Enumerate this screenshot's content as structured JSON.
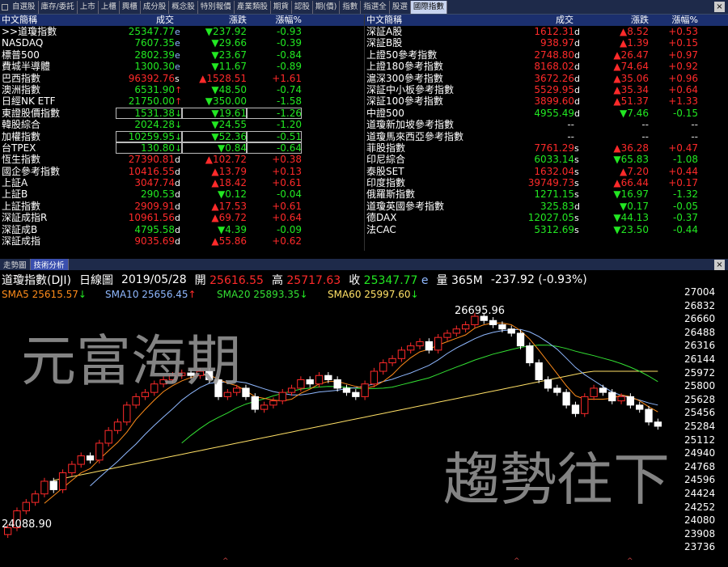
{
  "tabs": [
    "自選股",
    "庫存/委託",
    "上市",
    "上櫃",
    "興櫃",
    "成分股",
    "概念股",
    "特別報價",
    "產業類股",
    "期貨",
    "認股",
    "期(價)",
    "指數",
    "指選全",
    "股選",
    "國際指數"
  ],
  "left_header": {
    "name": "中文簡稱",
    "price": "成交",
    "change": "漲跌",
    "pct": "漲幅%"
  },
  "right_header": {
    "name": "中文簡稱",
    "price": "成交",
    "change": "漲跌",
    "pct": "漲幅%"
  },
  "left_rows": [
    {
      "name": ">>道瓊指數",
      "price": "25347.77",
      "suf": "e",
      "pc": "dn",
      "chg": "▼237.92",
      "cc": "dn",
      "pct": "-0.93",
      "box": false
    },
    {
      "name": "NASDAQ",
      "price": "7607.35",
      "suf": "e",
      "pc": "dn",
      "chg": "▼29.66",
      "cc": "dn",
      "pct": "-0.39",
      "box": false
    },
    {
      "name": "標普500",
      "price": "2802.39",
      "suf": "e",
      "pc": "dn",
      "chg": "▼23.67",
      "cc": "dn",
      "pct": "-0.84",
      "box": false
    },
    {
      "name": "費城半導體",
      "price": "1300.30",
      "suf": "e",
      "pc": "dn",
      "chg": "▼11.67",
      "cc": "dn",
      "pct": "-0.89",
      "box": false
    },
    {
      "name": "巴西指數",
      "price": "96392.76",
      "suf": "s",
      "pc": "up",
      "chg": "▲1528.51",
      "cc": "up",
      "pct": "+1.61",
      "box": false
    },
    {
      "name": "澳洲指數",
      "price": "6531.90",
      "suf": "↑",
      "pc": "dn",
      "chg": "▼48.50",
      "cc": "dn",
      "pct": "-0.74",
      "box": false
    },
    {
      "name": "日經NK ETF",
      "price": "21750.00",
      "suf": "↑",
      "pc": "dn",
      "chg": "▼350.00",
      "cc": "dn",
      "pct": "-1.58",
      "box": false
    },
    {
      "name": "東證股價指數",
      "price": "1531.38",
      "suf": "↓",
      "pc": "dn",
      "chg": "▼19.61",
      "cc": "dn",
      "pct": "-1.26",
      "box": true
    },
    {
      "name": "韓股綜合",
      "price": "2024.28",
      "suf": "↓",
      "pc": "dn",
      "chg": "▼24.55",
      "cc": "dn",
      "pct": "-1.20",
      "box": false
    },
    {
      "name": "加權指數",
      "price": "10259.95",
      "suf": "↓",
      "pc": "dn",
      "chg": "▼52.36",
      "cc": "dn",
      "pct": "-0.51",
      "box": true
    },
    {
      "name": "台TPEX",
      "price": "130.80",
      "suf": "↓",
      "pc": "dn",
      "chg": "▼0.84",
      "cc": "dn",
      "pct": "-0.64",
      "box": true
    },
    {
      "name": "恆生指數",
      "price": "27390.81",
      "suf": "d",
      "pc": "up",
      "chg": "▲102.72",
      "cc": "up",
      "pct": "+0.38",
      "box": false
    },
    {
      "name": "國企參考指數",
      "price": "10416.55",
      "suf": "d",
      "pc": "up",
      "chg": "▲13.79",
      "cc": "up",
      "pct": "+0.13",
      "box": false
    },
    {
      "name": "上証A",
      "price": "3047.74",
      "suf": "d",
      "pc": "up",
      "chg": "▲18.42",
      "cc": "up",
      "pct": "+0.61",
      "box": false
    },
    {
      "name": "上証B",
      "price": "290.53",
      "suf": "d",
      "pc": "dn",
      "chg": "▼0.12",
      "cc": "dn",
      "pct": "-0.04",
      "box": false
    },
    {
      "name": "上証指數",
      "price": "2909.91",
      "suf": "d",
      "pc": "up",
      "chg": "▲17.53",
      "cc": "up",
      "pct": "+0.61",
      "box": false
    },
    {
      "name": "深証成指R",
      "price": "10961.56",
      "suf": "d",
      "pc": "up",
      "chg": "▲69.72",
      "cc": "up",
      "pct": "+0.64",
      "box": false
    },
    {
      "name": "深証成B",
      "price": "4795.58",
      "suf": "d",
      "pc": "dn",
      "chg": "▼4.39",
      "cc": "dn",
      "pct": "-0.09",
      "box": false
    },
    {
      "name": "深証成指",
      "price": "9035.69",
      "suf": "d",
      "pc": "up",
      "chg": "▲55.86",
      "cc": "up",
      "pct": "+0.62",
      "box": false
    }
  ],
  "right_rows": [
    {
      "name": "深証A股",
      "price": "1612.31",
      "suf": "d",
      "pc": "up",
      "chg": "▲8.52",
      "cc": "up",
      "pct": "+0.53"
    },
    {
      "name": "深証B股",
      "price": "938.97",
      "suf": "d",
      "pc": "up",
      "chg": "▲1.39",
      "cc": "up",
      "pct": "+0.15"
    },
    {
      "name": "上證50參考指數",
      "price": "2748.80",
      "suf": "d",
      "pc": "up",
      "chg": "▲26.47",
      "cc": "up",
      "pct": "+0.97"
    },
    {
      "name": "上證180參考指數",
      "price": "8168.02",
      "suf": "d",
      "pc": "up",
      "chg": "▲74.64",
      "cc": "up",
      "pct": "+0.92"
    },
    {
      "name": "滬深300參考指數",
      "price": "3672.26",
      "suf": "d",
      "pc": "up",
      "chg": "▲35.06",
      "cc": "up",
      "pct": "+0.96"
    },
    {
      "name": "深証中小板參考指數",
      "price": "5529.95",
      "suf": "d",
      "pc": "up",
      "chg": "▲35.34",
      "cc": "up",
      "pct": "+0.64"
    },
    {
      "name": "深証100參考指數",
      "price": "3899.60",
      "suf": "d",
      "pc": "up",
      "chg": "▲51.37",
      "cc": "up",
      "pct": "+1.33"
    },
    {
      "name": "中證500",
      "price": "4955.49",
      "suf": "d",
      "pc": "dn",
      "chg": "▼7.46",
      "cc": "dn",
      "pct": "-0.15"
    },
    {
      "name": "道瓊新加坡參考指數",
      "price": "--",
      "suf": "",
      "pc": "fl",
      "chg": "--",
      "cc": "fl",
      "pct": "--"
    },
    {
      "name": "道瓊馬來西亞參考指數",
      "price": "--",
      "suf": "",
      "pc": "fl",
      "chg": "--",
      "cc": "fl",
      "pct": "--"
    },
    {
      "name": "菲股指數",
      "price": "7761.29",
      "suf": "s",
      "pc": "up",
      "chg": "▲36.28",
      "cc": "up",
      "pct": "+0.47"
    },
    {
      "name": "印尼綜合",
      "price": "6033.14",
      "suf": "s",
      "pc": "dn",
      "chg": "▼65.83",
      "cc": "dn",
      "pct": "-1.08"
    },
    {
      "name": "泰股SET",
      "price": "1632.04",
      "suf": "s",
      "pc": "up",
      "chg": "▲7.20",
      "cc": "up",
      "pct": "+0.44"
    },
    {
      "name": "印度指數",
      "price": "39749.73",
      "suf": "s",
      "pc": "up",
      "chg": "▲66.44",
      "cc": "up",
      "pct": "+0.17"
    },
    {
      "name": "俄羅斯指數",
      "price": "1271.15",
      "suf": "s",
      "pc": "dn",
      "chg": "▼16.97",
      "cc": "dn",
      "pct": "-1.32"
    },
    {
      "name": "道瓊英國參考指數",
      "price": "325.83",
      "suf": "d",
      "pc": "dn",
      "chg": "▼0.17",
      "cc": "dn",
      "pct": "-0.05"
    },
    {
      "name": "德DAX",
      "price": "12027.05",
      "suf": "s",
      "pc": "dn",
      "chg": "▼44.13",
      "cc": "dn",
      "pct": "-0.37"
    },
    {
      "name": "法CAC",
      "price": "5312.69",
      "suf": "s",
      "pc": "dn",
      "chg": "▼23.50",
      "cc": "dn",
      "pct": "-0.44"
    }
  ],
  "lower_tabs": [
    "走勢圖",
    "技術分析"
  ],
  "info": {
    "symbol": "道瓊指數(DJI)",
    "period": "日線圖",
    "date": "2019/05/28",
    "open_label": "開",
    "open": "25616.55",
    "high_label": "高",
    "high": "25717.63",
    "close_label": "收",
    "close": "25347.77",
    "close_suf": "e",
    "vol_label": "量",
    "vol": "365M",
    "change": "-237.92 (-0.93%)"
  },
  "sma": [
    {
      "label": "SMA5",
      "value": "25615.57",
      "arrow": "↓",
      "color": "#ff8c1a",
      "arrow_color": "#22e822"
    },
    {
      "label": "SMA10",
      "value": "25656.45",
      "arrow": "↑",
      "color": "#8fb8ff",
      "arrow_color": "#ff2a2a"
    },
    {
      "label": "SMA20",
      "value": "25893.35",
      "arrow": "↓",
      "color": "#33e033",
      "arrow_color": "#22e822"
    },
    {
      "label": "SMA60",
      "value": "25997.60",
      "arrow": "↓",
      "color": "#ffe066",
      "arrow_color": "#22e822"
    }
  ],
  "y_ticks": [
    "27004",
    "26832",
    "26660",
    "26488",
    "26316",
    "26144",
    "25972",
    "25800",
    "25628",
    "25456",
    "25284",
    "25112",
    "24940",
    "24768",
    "24596",
    "24424",
    "24252",
    "24080",
    "23908",
    "23736"
  ],
  "hi_label": "26695.96",
  "lo_label": "24088.90",
  "watermark1": "元富海期",
  "watermark2": "趨勢往下",
  "colors": {
    "up": "#ff2a2a",
    "down": "#22e822",
    "header_bg": "#1b2f6e"
  }
}
